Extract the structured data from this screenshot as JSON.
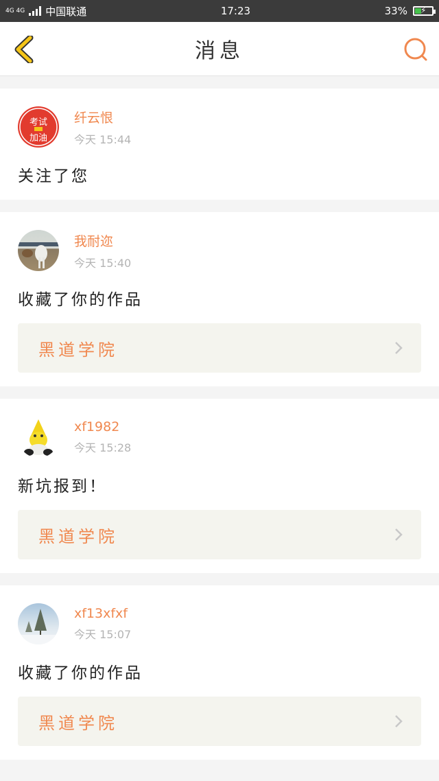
{
  "status_bar": {
    "network_top": "4G 4G",
    "carrier": "中国联通",
    "time": "17:23",
    "battery_percent": "33%",
    "battery_level": 0.33
  },
  "header": {
    "title": "消息",
    "back_icon": "chevron-left-icon",
    "search_icon": "search-icon"
  },
  "colors": {
    "accent": "#f0884f",
    "back_arrow": "#f5c518",
    "page_bg": "#f4f4f4",
    "link_bg": "#f4f4ee"
  },
  "messages": [
    {
      "username": "纤云恨",
      "time": "今天 15:44",
      "text": "关注了您",
      "link": null
    },
    {
      "username": "我耐迩",
      "time": "今天 15:40",
      "text": "收藏了你的作品",
      "link": "黑道学院"
    },
    {
      "username": "xf1982",
      "time": "今天 15:28",
      "text": "新坑报到！",
      "link": "黑道学院"
    },
    {
      "username": "xf13xfxf",
      "time": "今天 15:07",
      "text": "收藏了你的作品",
      "link": "黑道学院"
    }
  ],
  "avatar_badge": {
    "line1": "考试",
    "line2": "加油"
  }
}
